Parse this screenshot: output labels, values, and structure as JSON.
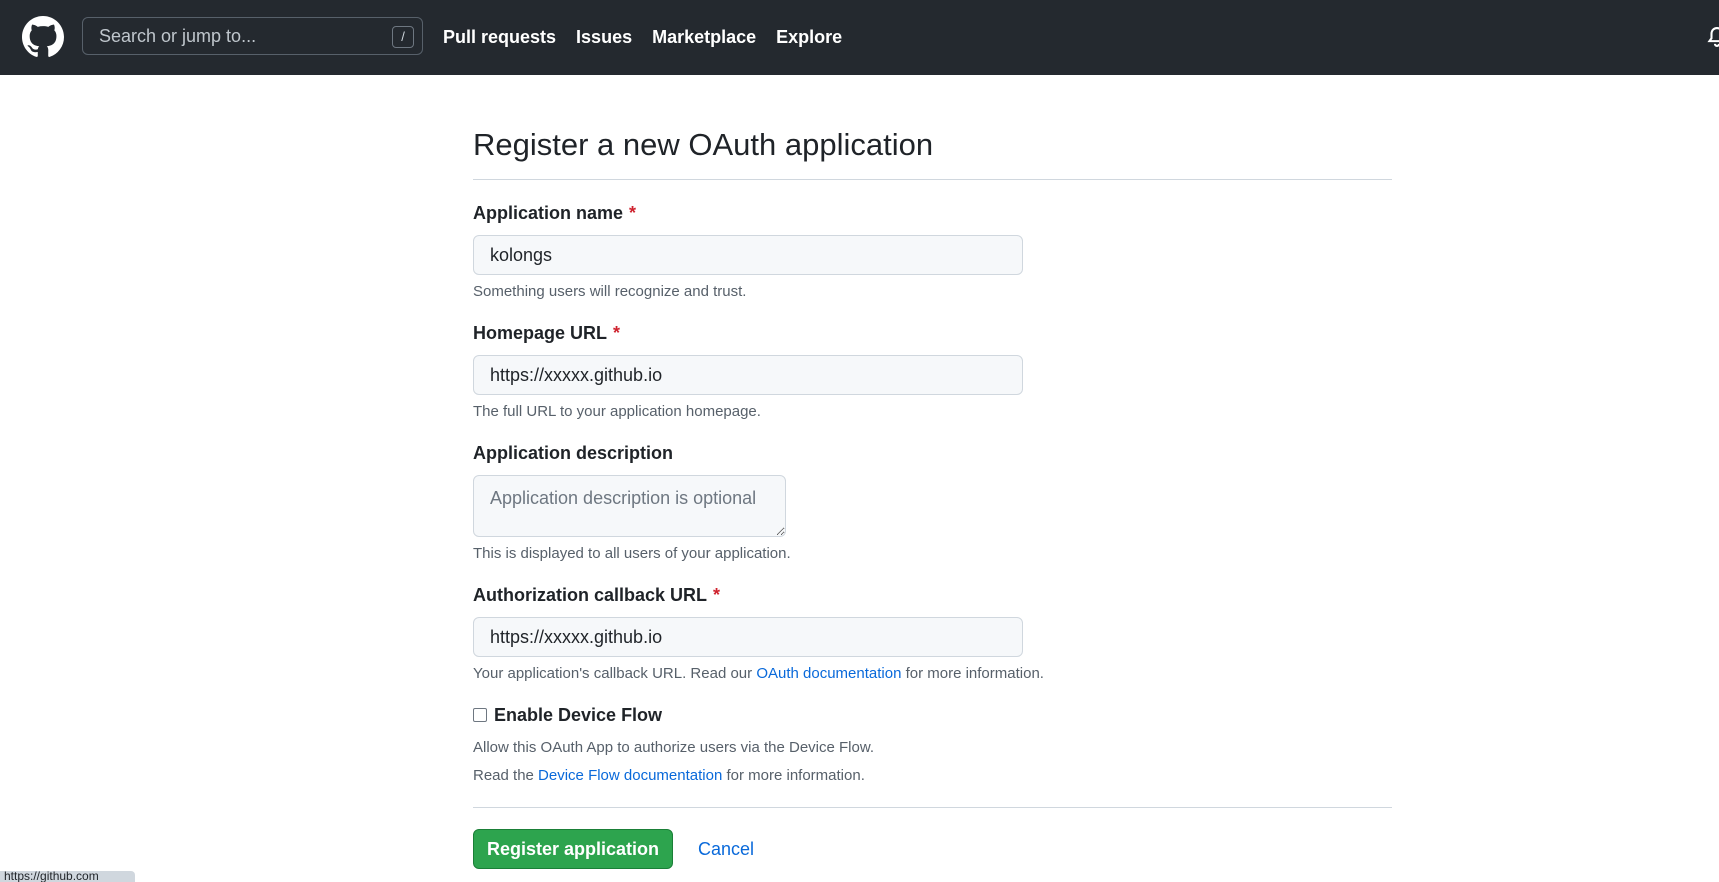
{
  "header": {
    "search_placeholder": "Search or jump to...",
    "search_shortcut": "/",
    "nav": [
      "Pull requests",
      "Issues",
      "Marketplace",
      "Explore"
    ]
  },
  "form": {
    "title": "Register a new OAuth application",
    "app_name": {
      "label": "Application name",
      "required_mark": "*",
      "value": "kolongs",
      "note": "Something users will recognize and trust."
    },
    "homepage": {
      "label": "Homepage URL",
      "required_mark": "*",
      "value": "https://xxxxx.github.io",
      "note": "The full URL to your application homepage."
    },
    "description": {
      "label": "Application description",
      "placeholder": "Application description is optional",
      "note": "This is displayed to all users of your application."
    },
    "callback": {
      "label": "Authorization callback URL",
      "required_mark": "*",
      "value": "https://xxxxx.github.io",
      "note_before": "Your application's callback URL. Read our ",
      "note_link": "OAuth documentation",
      "note_after": " for more information."
    },
    "device_flow": {
      "label": "Enable Device Flow",
      "checked": false,
      "note_line1": "Allow this OAuth App to authorize users via the Device Flow.",
      "note_before": "Read the ",
      "note_link": "Device Flow documentation",
      "note_after": " for more information."
    },
    "register_button": "Register application",
    "cancel_link": "Cancel"
  },
  "status_bar": "https://github.com",
  "colors": {
    "header_bg": "#24292f",
    "primary_button": "#2da44e",
    "link": "#0969da",
    "required": "#cf222e"
  },
  "icons": [
    "github-logo-icon",
    "bell-icon"
  ]
}
